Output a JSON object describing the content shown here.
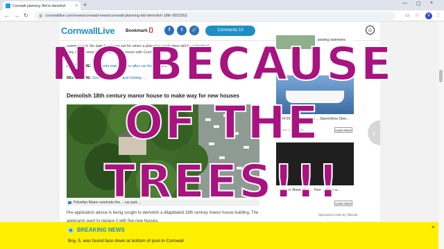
{
  "browser": {
    "tab_title": "Cornwall planning: Bid to demolish",
    "tab_close": "×",
    "new_tab": "+",
    "minimize": "—",
    "maximize": "▢",
    "close": "×",
    "back": "←",
    "forward": "→",
    "reload": "↻",
    "url": "cornwalllive.com/news/cornwall-news/cornwall-planning-bid-demolish-18th-9553353",
    "profile_initial": "V"
  },
  "site": {
    "logo": "CornwallLive",
    "bookmark_label": "Bookmark",
    "comments_label": "Comments 10",
    "share_facebook": "f",
    "share_twitter": "t",
    "share_link": "🔗"
  },
  "article": {
    "para1": "commenced. No date has been set for when a planning application will be submitted,",
    "para2": "they can ... view the ... planning process with Cornwall Council ...",
    "read_more_1_label": "READ MORE:",
    "read_more_1_link": "Residents warn drivers after car fire incident ...",
    "read_more_2_label": "READ MORE:",
    "read_more_2_link": "Great Western ... and holiday ...",
    "headline": "Demolish 18th century manor house to make way for new houses",
    "caption": "Polvellan Manor overlooks the ... car park ... ",
    "body": "Pre-application advice is being sought to demolish a dilapidated 18th century manor house building. The applicants want to replace it with five new houses."
  },
  "sidebar": {
    "ad1_label": "pesting swimmers",
    "ad2_title": "2024-2025 Cruise Cabin ... Speechless (See...",
    "ad2_source": "Cruises | Search Ads",
    "ad2_learn": "Learn More",
    "ad3_title": "...culator Shows The ... Your ... (Take a...",
    "ad3_learn": "Learn More",
    "taboola": "Sponsored Links by Taboola"
  },
  "overlay": {
    "line1": "NO BECAUSE",
    "line2": "OF THE",
    "line3": "TREES!!!"
  },
  "breaking": {
    "title": "BREAKING NEWS",
    "text": "Boy, 5, was found face down at bottom of pool in Cornwall",
    "close": "×"
  },
  "colors": {
    "brand": "#1e8fc4",
    "overlay_text": "#a8137f",
    "breaking_bg": "#ffef00"
  }
}
